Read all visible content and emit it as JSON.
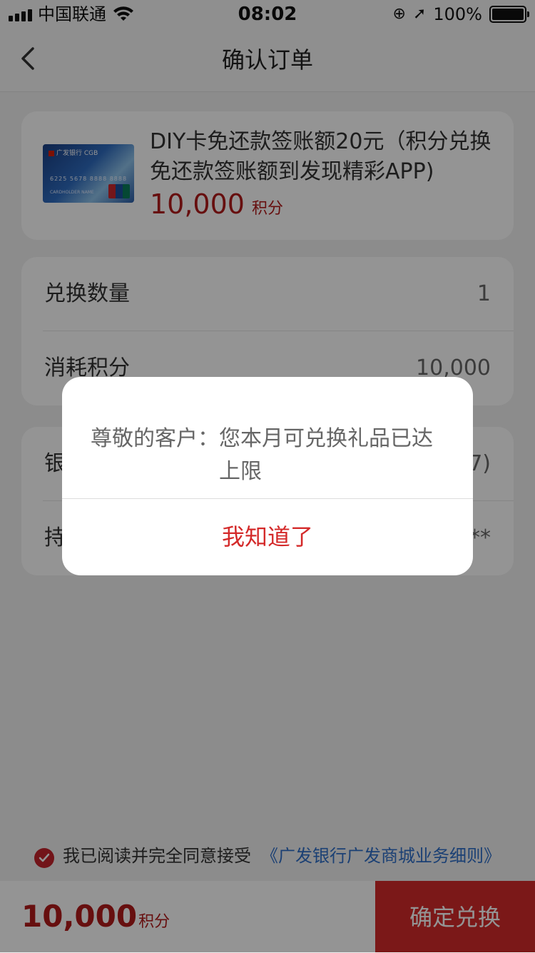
{
  "status_bar": {
    "carrier": "中国联通",
    "time": "08:02",
    "battery": "100%"
  },
  "nav": {
    "title": "确认订单"
  },
  "product": {
    "title": "DIY卡免还款签账额20元（积分兑换免还款签账额到发现精彩APP)",
    "price": "10,000",
    "price_unit": "积分",
    "image_logo": "广发银行 CGB",
    "image_number": "6225 5678 8888 8888",
    "image_name": "CARDHOLDER NAME"
  },
  "details": {
    "rows": [
      {
        "label": "兑换数量",
        "value": "1"
      },
      {
        "label": "消耗积分",
        "value": "10,000"
      }
    ]
  },
  "account": {
    "rows": [
      {
        "label": "银",
        "value": "7)"
      },
      {
        "label": "持",
        "value": "**"
      }
    ]
  },
  "agreement": {
    "text": "我已阅读并完全同意接受",
    "link": "《广发银行广发商城业务细则》"
  },
  "footer": {
    "total": "10,000",
    "total_unit": "积分",
    "confirm_label": "确定兑换"
  },
  "dialog": {
    "prefix": "尊敬的客户：",
    "message": "您本月可兑换礼品已达上限",
    "button_label": "我知道了"
  },
  "colors": {
    "accent_red": "#d42a2a",
    "price_red": "#b11b1b",
    "link_blue": "#2f6fc9"
  }
}
